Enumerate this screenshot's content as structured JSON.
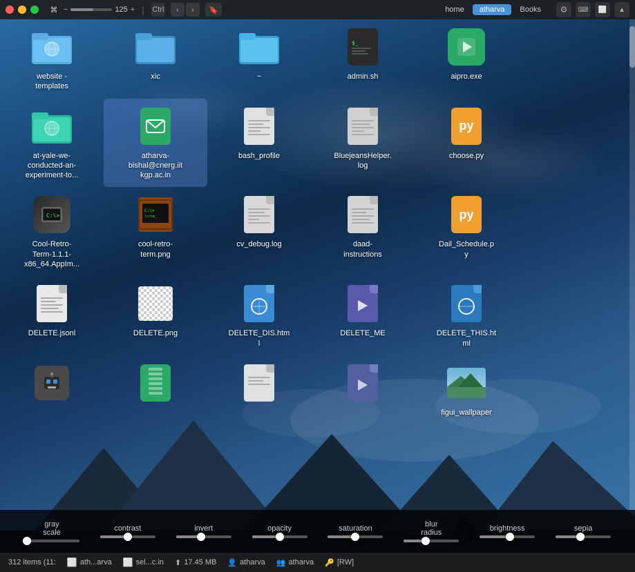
{
  "menubar": {
    "zoom_level": "125",
    "nav_back_label": "‹",
    "nav_forward_label": "›",
    "tabs": [
      {
        "id": "home",
        "label": "home",
        "active": false
      },
      {
        "id": "atharva",
        "label": "atharva",
        "active": true
      },
      {
        "id": "books",
        "label": "Books",
        "active": false
      }
    ],
    "icons": [
      "⚙",
      "⌨",
      "⬜",
      "▲"
    ]
  },
  "files": [
    {
      "id": "website-templates",
      "label": "website -\ntemplates",
      "type": "folder-blue",
      "row": 0
    },
    {
      "id": "xic",
      "label": "xic",
      "type": "folder-blue-open",
      "row": 0
    },
    {
      "id": "tilde",
      "label": "~",
      "type": "folder-open-teal",
      "row": 0
    },
    {
      "id": "admin-sh",
      "label": "admin.sh",
      "type": "shell",
      "row": 0
    },
    {
      "id": "aipro-exe",
      "label": "aipro.exe",
      "type": "exe",
      "row": 0
    },
    {
      "id": "at-yale",
      "label": "at-yale-we-\nconducted-an-\nexperiment-to...",
      "type": "folder-teal",
      "row": 1
    },
    {
      "id": "atharva-email",
      "label": "atharva-\nbishal@cnerg.iit\nkgp.ac.in",
      "type": "selected-file",
      "row": 1
    },
    {
      "id": "bash-profile",
      "label": "bash_profile",
      "type": "doc",
      "row": 1
    },
    {
      "id": "bluejeans-log",
      "label": "BluejeansHelper.\nlog",
      "type": "log",
      "row": 1
    },
    {
      "id": "choose-py",
      "label": "choose.py",
      "type": "python",
      "row": 1
    },
    {
      "id": "cool-retro-term",
      "label": "Cool-Retro-\nTerm-1.1.1-\nx86_64.AppIm...",
      "type": "app",
      "row": 2
    },
    {
      "id": "cool-retro-png",
      "label": "cool-retro-\nterm.png",
      "type": "retro-png",
      "row": 2
    },
    {
      "id": "cv-debug-log",
      "label": "cv_debug.log",
      "type": "doc",
      "row": 2
    },
    {
      "id": "daad-instructions",
      "label": "daad-\ninstructions",
      "type": "doc-grey",
      "row": 2
    },
    {
      "id": "dail-schedule-py",
      "label": "Dail_Schedule.p\ny",
      "type": "python",
      "row": 2
    },
    {
      "id": "delete-jsonl",
      "label": "DELETE.jsonl",
      "type": "doc-white",
      "row": 3
    },
    {
      "id": "delete-png",
      "label": "DELETE.png",
      "type": "checkered-png",
      "row": 3
    },
    {
      "id": "delete-dis-html",
      "label": "DELETE_DIS.htm\nl",
      "type": "html",
      "row": 3
    },
    {
      "id": "delete-me",
      "label": "DELETE_ME",
      "type": "video",
      "row": 3
    },
    {
      "id": "delete-this-html",
      "label": "DELETE_THIS.ht\nml",
      "type": "html2",
      "row": 3
    },
    {
      "id": "robot-icon",
      "label": "",
      "type": "robot",
      "row": 4
    },
    {
      "id": "zip-file",
      "label": "",
      "type": "zip",
      "row": 4
    },
    {
      "id": "doc-plain",
      "label": "",
      "type": "doc-plain",
      "row": 4
    },
    {
      "id": "video2",
      "label": "",
      "type": "video2",
      "row": 4
    },
    {
      "id": "figui-wallpaper",
      "label": "figui_wallpaper",
      "type": "image-preview",
      "row": 4
    }
  ],
  "filter_bar": {
    "items": [
      {
        "id": "grayscale",
        "label": "gray\nscale",
        "value": 5
      },
      {
        "id": "contrast",
        "label": "contrast",
        "value": 50
      },
      {
        "id": "invert",
        "label": "invert",
        "value": 45
      },
      {
        "id": "opacity",
        "label": "opacity",
        "value": 50
      },
      {
        "id": "saturation",
        "label": "saturation",
        "value": 50
      },
      {
        "id": "blur",
        "label": "blur\nradius",
        "value": 40
      },
      {
        "id": "brightness",
        "label": "brightness",
        "value": 55
      },
      {
        "id": "sepia",
        "label": "sepia",
        "value": 45
      }
    ]
  },
  "status_bar": {
    "item_count": "312 items (11:",
    "app1": "ath...arva",
    "app2": "sel...c.in",
    "disk": "17.45 MB",
    "user1": "atharva",
    "user2": "atharva",
    "mode": "[RW]"
  }
}
